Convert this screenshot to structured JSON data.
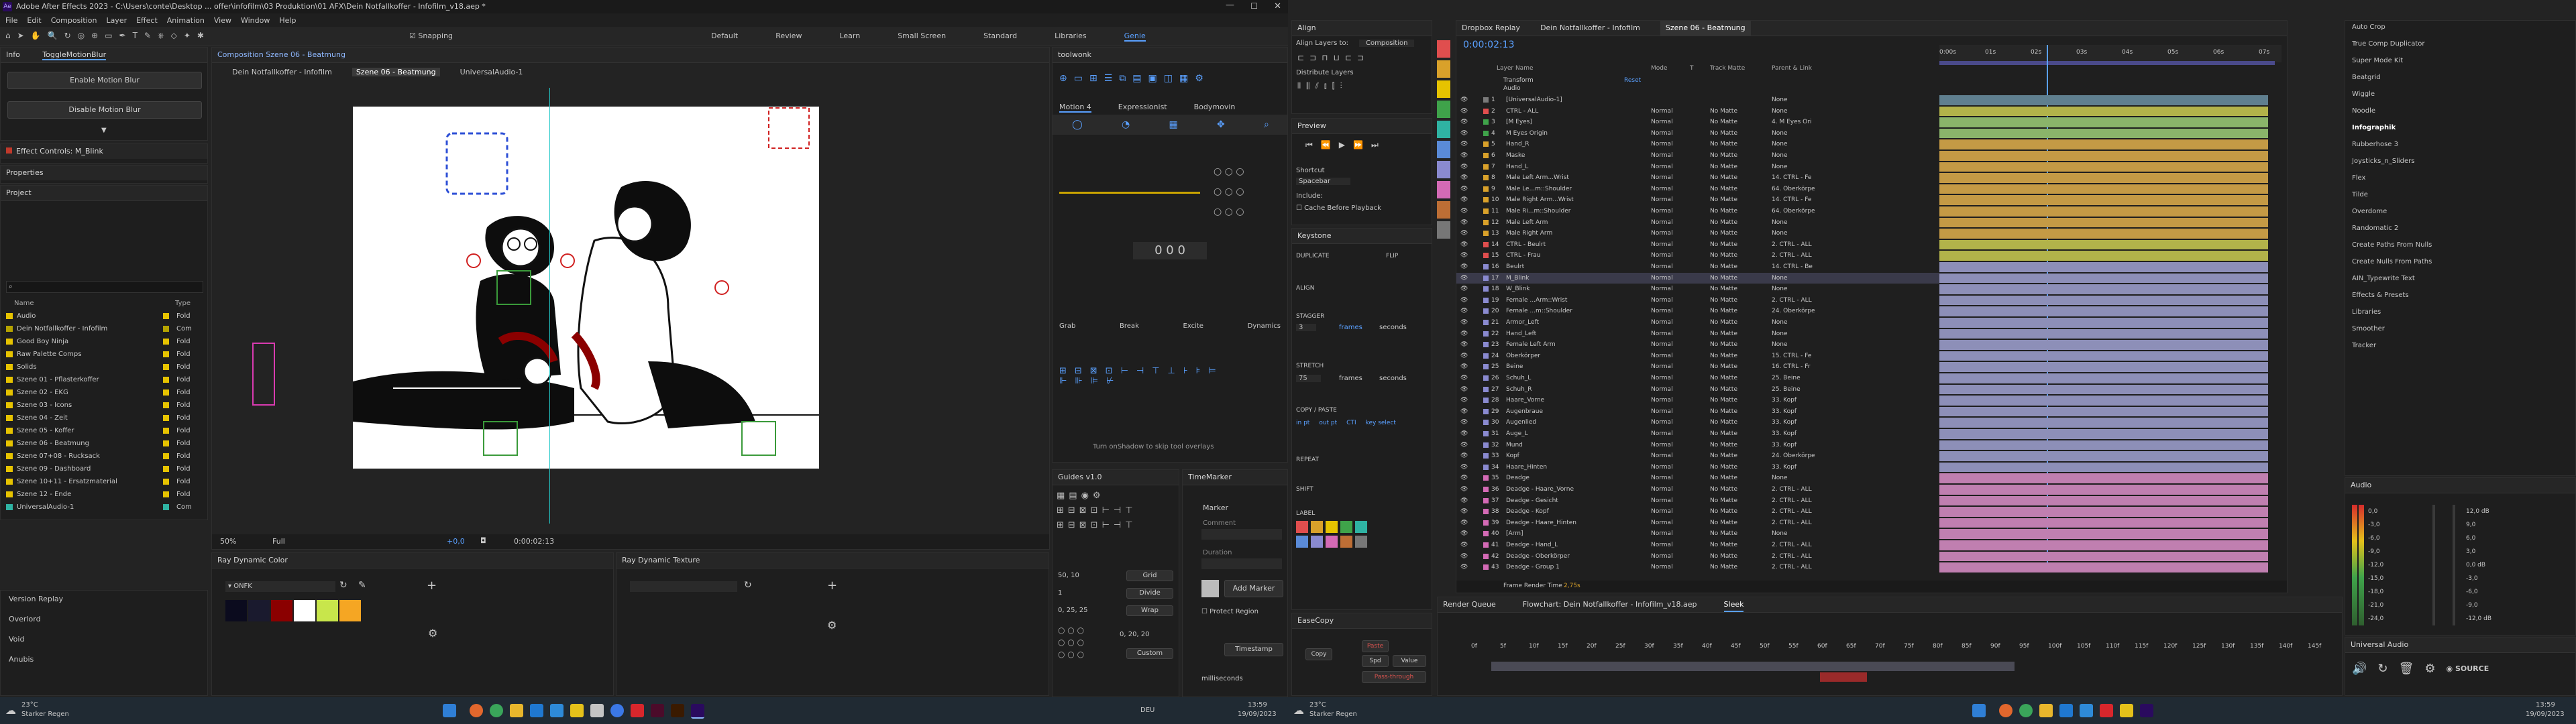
{
  "left": {
    "title_bar": "Adobe After Effects 2023 - C:\\Users\\conte\\Desktop ... offer\\infofilm\\03 Produktion\\01 AFX\\Dein Notfallkoffer - Infofilm_v18.aep *",
    "menu": [
      "File",
      "Edit",
      "Composition",
      "Layer",
      "Effect",
      "Animation",
      "View",
      "Window",
      "Help"
    ],
    "workspaces": [
      "Default",
      "Review",
      "Learn",
      "Small Screen",
      "Standard",
      "Libraries",
      "Genie"
    ],
    "snapping": "Snapping",
    "info_tabs": [
      "Info",
      "ToggleMotionBlur"
    ],
    "motion_blur_buttons": [
      "Enable Motion Blur",
      "Disable Motion Blur"
    ],
    "effect_controls": "Effect Controls: M_Blink",
    "properties": "Properties",
    "project": {
      "title": "Project",
      "search_placeholder": "",
      "columns": [
        "Name",
        "Type"
      ],
      "items": [
        {
          "name": "Audio",
          "type": "Fold",
          "color": "#e6c300"
        },
        {
          "name": "Dein Notfallkoffer - Infofilm",
          "type": "Com",
          "color": "#b5a300"
        },
        {
          "name": "Good Boy Ninja",
          "type": "Fold",
          "color": "#e6c300"
        },
        {
          "name": "Raw Palette Comps",
          "type": "Fold",
          "color": "#e6c300"
        },
        {
          "name": "Solids",
          "type": "Fold",
          "color": "#e6c300"
        },
        {
          "name": "Szene 01 - Pflasterkoffer",
          "type": "Fold",
          "color": "#e6c300"
        },
        {
          "name": "Szene 02 - EKG",
          "type": "Fold",
          "color": "#e6c300"
        },
        {
          "name": "Szene 03 - Icons",
          "type": "Fold",
          "color": "#e6c300"
        },
        {
          "name": "Szene 04 - Zeit",
          "type": "Fold",
          "color": "#e6c300"
        },
        {
          "name": "Szene 05 - Koffer",
          "type": "Fold",
          "color": "#e6c300"
        },
        {
          "name": "Szene 06 - Beatmung",
          "type": "Fold",
          "color": "#e6c300"
        },
        {
          "name": "Szene 07+08 - Rucksack",
          "type": "Fold",
          "color": "#e6c300"
        },
        {
          "name": "Szene 09 - Dashboard",
          "type": "Fold",
          "color": "#e6c300"
        },
        {
          "name": "Szene 10+11 - Ersatzmaterial",
          "type": "Fold",
          "color": "#e6c300"
        },
        {
          "name": "Szene 12 - Ende",
          "type": "Fold",
          "color": "#e6c300"
        },
        {
          "name": "UniversalAudio-1",
          "type": "Com",
          "color": "#2fb3a3"
        }
      ]
    },
    "lower_left": [
      "Version Replay",
      "Overlord",
      "Void",
      "Anubis"
    ],
    "composition": {
      "tab": "Composition Szene 06 - Beatmung",
      "breadcrumbs": [
        "Dein Notfallkoffer - Infofilm",
        "Szene 06 - Beatmung",
        "UniversalAudio-1"
      ],
      "zoom": "50%",
      "quality": "Full",
      "exposure": "+0,0",
      "timecode": "0:00:02:13"
    },
    "right_tabs": {
      "toolbar": "toolwonk",
      "motion_tabs": [
        "Motion 4",
        "Expressionist",
        "Bodymovin"
      ],
      "buttons": [
        "Grab",
        "Break",
        "Excite",
        "Dynamics"
      ],
      "footer": "Turn onShadow to skip tool overlays",
      "guides_title": "Guides v1.0",
      "guides_grid": [
        "Grid",
        "Divide",
        "Wrap",
        "Custom"
      ],
      "guides_values": [
        "50, 10",
        "1",
        "0, 25, 25",
        "0, 20, 20"
      ],
      "timemarker_title": "TimeMarker",
      "marker": "Marker",
      "comment": "Comment",
      "duration": "Duration",
      "add_marker": "Add Marker",
      "protect_region": "Protect Region",
      "timestamp": "Timestamp",
      "milliseconds": "milliseconds"
    },
    "ray_color": {
      "title": "Ray Dynamic Color",
      "palette": "ONFK",
      "swatches": [
        "#0b0b1e",
        "#1a1a2e",
        "#8b0000",
        "#ffffff",
        "#c8e64b",
        "#f5a623"
      ]
    },
    "ray_texture": {
      "title": "Ray Dynamic Texture"
    },
    "taskbar": {
      "weather": "23°C",
      "weather_desc": "Starker Regen",
      "lang": "DEU",
      "time": "13:59",
      "date": "19/09/2023"
    }
  },
  "right": {
    "align": {
      "title": "Align",
      "align_to_label": "Align Layers to:",
      "align_to": "Composition",
      "distribute": "Distribute Layers"
    },
    "preview": {
      "title": "Preview",
      "shortcut_label": "Shortcut",
      "shortcut": "Spacebar",
      "include": "Include:",
      "cache": "Cache Before Playback"
    },
    "keystone": {
      "title": "Keystone",
      "labels": [
        "DUPLICATE",
        "FLIP",
        "ALIGN",
        "STAGGER",
        "frames",
        "seconds",
        "STRETCH",
        "frames",
        "seconds",
        "COPY / PASTE",
        "REPEAT",
        "SHIFT",
        "LABEL"
      ],
      "stagger_val": "3",
      "stretch_val": "75",
      "ease_labels": [
        "in pt",
        "out pt",
        "CTI",
        "key select"
      ]
    },
    "easecopy": {
      "title": "EaseCopy",
      "buttons": [
        "Copy",
        "Paste",
        "Spd",
        "Value",
        "Pass-through"
      ]
    },
    "dropbox_replay": "Dropbox Replay",
    "timeline_tabs": [
      "Dein Notfallkoffer - Infofilm",
      "Szene 06 - Beatmung"
    ],
    "timecode": "0:00:02:13",
    "layer_cols": [
      "Layer Name",
      "Mode",
      "T",
      "Track Matte",
      "Parent & Link"
    ],
    "transform": "Transform",
    "reset": "Reset",
    "audio_row": "Audio",
    "layers": [
      {
        "n": "1",
        "name": "[UniversalAudio-1]",
        "mode": "",
        "matte": "",
        "parent": "None",
        "color": "#7a7a7a",
        "track": "#5f7f8f"
      },
      {
        "n": "2",
        "name": "CTRL - ALL",
        "mode": "Normal",
        "matte": "No Matte",
        "parent": "None",
        "color": "#e04e4e",
        "track": "#b2b34a"
      },
      {
        "n": "3",
        "name": "[M Eyes]",
        "mode": "Normal",
        "matte": "No Matte",
        "parent": "4. M Eyes Ori",
        "color": "#3fa34a",
        "track": "#8ab46a"
      },
      {
        "n": "4",
        "name": "M Eyes Origin",
        "mode": "Normal",
        "matte": "No Matte",
        "parent": "None",
        "color": "#3fa34a",
        "track": "#8ab46a"
      },
      {
        "n": "5",
        "name": "Hand_R",
        "mode": "Normal",
        "matte": "No Matte",
        "parent": "None",
        "color": "#d9a12a",
        "track": "#c49a45"
      },
      {
        "n": "6",
        "name": "Maske",
        "mode": "Normal",
        "matte": "No Matte",
        "parent": "None",
        "color": "#d9a12a",
        "track": "#c49a45"
      },
      {
        "n": "7",
        "name": "Hand_L",
        "mode": "Normal",
        "matte": "No Matte",
        "parent": "None",
        "color": "#d9a12a",
        "track": "#c49a45"
      },
      {
        "n": "8",
        "name": "Male Left Arm...Wrist",
        "mode": "Normal",
        "matte": "No Matte",
        "parent": "14. CTRL - Fe",
        "color": "#d9a12a",
        "track": "#c49a45"
      },
      {
        "n": "9",
        "name": "Male Le...m::Shoulder",
        "mode": "Normal",
        "matte": "No Matte",
        "parent": "64. Oberkörpe",
        "color": "#d9a12a",
        "track": "#c49a45"
      },
      {
        "n": "10",
        "name": "Male Right Arm...Wrist",
        "mode": "Normal",
        "matte": "No Matte",
        "parent": "14. CTRL - Fe",
        "color": "#d9a12a",
        "track": "#c49a45"
      },
      {
        "n": "11",
        "name": "Male Ri...m::Shoulder",
        "mode": "Normal",
        "matte": "No Matte",
        "parent": "64. Oberkörpe",
        "color": "#d9a12a",
        "track": "#c49a45"
      },
      {
        "n": "12",
        "name": "Male Left Arm",
        "mode": "Normal",
        "matte": "No Matte",
        "parent": "None",
        "color": "#d9a12a",
        "track": "#c49a45"
      },
      {
        "n": "13",
        "name": "Male Right Arm",
        "mode": "Normal",
        "matte": "No Matte",
        "parent": "None",
        "color": "#d9a12a",
        "track": "#c49a45"
      },
      {
        "n": "14",
        "name": "CTRL - Beulrt",
        "mode": "Normal",
        "matte": "No Matte",
        "parent": "2. CTRL - ALL",
        "color": "#e04e4e",
        "track": "#b2b34a"
      },
      {
        "n": "15",
        "name": "CTRL - Frau",
        "mode": "Normal",
        "matte": "No Matte",
        "parent": "2. CTRL - ALL",
        "color": "#e04e4e",
        "track": "#b2b34a"
      },
      {
        "n": "16",
        "name": "Beulrt",
        "mode": "Normal",
        "matte": "No Matte",
        "parent": "14. CTRL - Be",
        "color": "#8a8ad0",
        "track": "#8d8fb8"
      },
      {
        "n": "17",
        "name": "M_Blink",
        "mode": "Normal",
        "matte": "No Matte",
        "parent": "None",
        "color": "#8a8ad0",
        "track": "#8d8fb8"
      },
      {
        "n": "18",
        "name": "W_Blink",
        "mode": "Normal",
        "matte": "No Matte",
        "parent": "None",
        "color": "#8a8ad0",
        "track": "#8d8fb8"
      },
      {
        "n": "19",
        "name": "Female ...Arm::Wrist",
        "mode": "Normal",
        "matte": "No Matte",
        "parent": "2. CTRL - ALL",
        "color": "#8a8ad0",
        "track": "#8d8fb8"
      },
      {
        "n": "20",
        "name": "Female ...m::Shoulder",
        "mode": "Normal",
        "matte": "No Matte",
        "parent": "24. Oberkörpe",
        "color": "#8a8ad0",
        "track": "#8d8fb8"
      },
      {
        "n": "21",
        "name": "Armor_Left",
        "mode": "Normal",
        "matte": "No Matte",
        "parent": "None",
        "color": "#8a8ad0",
        "track": "#8d8fb8"
      },
      {
        "n": "22",
        "name": "Hand_Left",
        "mode": "Normal",
        "matte": "No Matte",
        "parent": "None",
        "color": "#8a8ad0",
        "track": "#8d8fb8"
      },
      {
        "n": "23",
        "name": "Female Left Arm",
        "mode": "Normal",
        "matte": "No Matte",
        "parent": "None",
        "color": "#8a8ad0",
        "track": "#8d8fb8"
      },
      {
        "n": "24",
        "name": "Oberkörper",
        "mode": "Normal",
        "matte": "No Matte",
        "parent": "15. CTRL - Fe",
        "color": "#8a8ad0",
        "track": "#8d8fb8"
      },
      {
        "n": "25",
        "name": "Beine",
        "mode": "Normal",
        "matte": "No Matte",
        "parent": "16. CTRL - Fr",
        "color": "#8a8ad0",
        "track": "#8d8fb8"
      },
      {
        "n": "26",
        "name": "Schuh_L",
        "mode": "Normal",
        "matte": "No Matte",
        "parent": "25. Beine",
        "color": "#8a8ad0",
        "track": "#8d8fb8"
      },
      {
        "n": "27",
        "name": "Schuh_R",
        "mode": "Normal",
        "matte": "No Matte",
        "parent": "25. Beine",
        "color": "#8a8ad0",
        "track": "#8d8fb8"
      },
      {
        "n": "28",
        "name": "Haare_Vorne",
        "mode": "Normal",
        "matte": "No Matte",
        "parent": "33. Kopf",
        "color": "#8a8ad0",
        "track": "#8d8fb8"
      },
      {
        "n": "29",
        "name": "Augenbraue",
        "mode": "Normal",
        "matte": "No Matte",
        "parent": "33. Kopf",
        "color": "#8a8ad0",
        "track": "#8d8fb8"
      },
      {
        "n": "30",
        "name": "Augenlied",
        "mode": "Normal",
        "matte": "No Matte",
        "parent": "33. Kopf",
        "color": "#8a8ad0",
        "track": "#8d8fb8"
      },
      {
        "n": "31",
        "name": "Auge_L",
        "mode": "Normal",
        "matte": "No Matte",
        "parent": "33. Kopf",
        "color": "#8a8ad0",
        "track": "#8d8fb8"
      },
      {
        "n": "32",
        "name": "Mund",
        "mode": "Normal",
        "matte": "No Matte",
        "parent": "33. Kopf",
        "color": "#8a8ad0",
        "track": "#8d8fb8"
      },
      {
        "n": "33",
        "name": "Kopf",
        "mode": "Normal",
        "matte": "No Matte",
        "parent": "24. Oberkörpe",
        "color": "#8a8ad0",
        "track": "#8d8fb8"
      },
      {
        "n": "34",
        "name": "Haare_Hinten",
        "mode": "Normal",
        "matte": "No Matte",
        "parent": "33. Kopf",
        "color": "#8a8ad0",
        "track": "#8d8fb8"
      },
      {
        "n": "35",
        "name": "Deadge",
        "mode": "Normal",
        "matte": "No Matte",
        "parent": "None",
        "color": "#d46ab5",
        "track": "#c07fb0"
      },
      {
        "n": "36",
        "name": "Deadge - Haare_Vorne",
        "mode": "Normal",
        "matte": "No Matte",
        "parent": "2. CTRL - ALL",
        "color": "#d46ab5",
        "track": "#c07fb0"
      },
      {
        "n": "37",
        "name": "Deadge - Gesicht",
        "mode": "Normal",
        "matte": "No Matte",
        "parent": "2. CTRL - ALL",
        "color": "#d46ab5",
        "track": "#c07fb0"
      },
      {
        "n": "38",
        "name": "Deadge - Kopf",
        "mode": "Normal",
        "matte": "No Matte",
        "parent": "2. CTRL - ALL",
        "color": "#d46ab5",
        "track": "#c07fb0"
      },
      {
        "n": "39",
        "name": "Deadge - Haare_Hinten",
        "mode": "Normal",
        "matte": "No Matte",
        "parent": "2. CTRL - ALL",
        "color": "#d46ab5",
        "track": "#c07fb0"
      },
      {
        "n": "40",
        "name": "[Arm]",
        "mode": "Normal",
        "matte": "No Matte",
        "parent": "None",
        "color": "#d46ab5",
        "track": "#c07fb0"
      },
      {
        "n": "41",
        "name": "Deadge - Hand_L",
        "mode": "Normal",
        "matte": "No Matte",
        "parent": "2. CTRL - ALL",
        "color": "#d46ab5",
        "track": "#c07fb0"
      },
      {
        "n": "42",
        "name": "Deadge - Oberkörper",
        "mode": "Normal",
        "matte": "No Matte",
        "parent": "2. CTRL - ALL",
        "color": "#d46ab5",
        "track": "#c07fb0"
      },
      {
        "n": "43",
        "name": "Deadge - Group 1",
        "mode": "Normal",
        "matte": "No Matte",
        "parent": "2. CTRL - ALL",
        "color": "#d46ab5",
        "track": "#c07fb0"
      }
    ],
    "frame_render": "Frame Render Time",
    "frame_render_val": "2,75s",
    "ruler": [
      "0:00s",
      "01s",
      "02s",
      "03s",
      "04s",
      "05s",
      "06s",
      "07s"
    ],
    "render_queue_tabs": [
      "Render Queue",
      "Flowchart: Dein Notfallkoffer - Infofilm_v18.aep",
      "Sleek"
    ],
    "lower_ruler": [
      "0f",
      "5f",
      "10f",
      "15f",
      "20f",
      "25f",
      "30f",
      "35f",
      "40f",
      "45f",
      "50f",
      "55f",
      "60f",
      "65f",
      "70f",
      "75f",
      "80f",
      "85f",
      "90f",
      "95f",
      "100f",
      "105f",
      "110f",
      "115f",
      "120f",
      "125f",
      "130f",
      "135f",
      "140f",
      "145f"
    ],
    "effects_list": [
      "Auto Crop",
      "True Comp Duplicator",
      "Super Mode Kit",
      "Beatgrid",
      "Wiggle",
      "Noodle",
      "Infographik",
      "Rubberhose 3",
      "Joysticks_n_Sliders",
      "Flex",
      "Tilde",
      "Overdome",
      "Randomatic 2",
      "Create Paths From Nulls",
      "Create Nulls From Paths",
      "AIN_Typewrite Text",
      "Effects & Presets",
      "Libraries",
      "Smoother",
      "Tracker"
    ],
    "audio_title": "Audio",
    "audio_db": [
      "12,0 dB",
      "9,0",
      "6,0",
      "3,0",
      "0,0 dB",
      "-3,0",
      "-6,0",
      "-9,0",
      "-12,0 dB"
    ],
    "audio_left": [
      "0,0",
      "-3,0",
      "-6,0",
      "-9,0",
      "-12,0",
      "-15,0",
      "-18,0",
      "-21,0",
      "-24,0"
    ],
    "universal_audio": "Universal Audio",
    "source": "SOURCE",
    "taskbar": {
      "weather": "23°C",
      "weather_desc": "Starker Regen",
      "time": "13:59",
      "date": "19/09/2023"
    },
    "color_labels": [
      "#e04e4e",
      "#d9a12a",
      "#e6c300",
      "#3fa34a",
      "#2fb3a3",
      "#5a8bd8",
      "#8a8ad0",
      "#d46ab5",
      "#bd6e35",
      "#777777"
    ]
  }
}
